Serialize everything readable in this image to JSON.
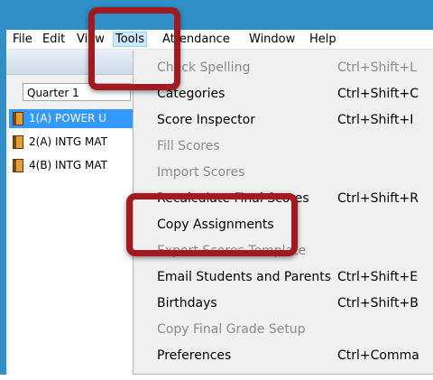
{
  "menubar": {
    "items": [
      {
        "label": "File"
      },
      {
        "label": "Edit"
      },
      {
        "label": "View"
      },
      {
        "label": "Tools"
      },
      {
        "label": "Attendance"
      },
      {
        "label": "Window"
      },
      {
        "label": "Help"
      }
    ]
  },
  "left_pane": {
    "term_select": "Quarter 1",
    "classes": [
      {
        "label": "1(A) POWER U",
        "selected": true
      },
      {
        "label": "2(A) INTG MAT",
        "selected": false
      },
      {
        "label": "4(B) INTG MAT",
        "selected": false
      }
    ]
  },
  "tools_menu": {
    "items": [
      {
        "label": "Check Spelling",
        "shortcut": "Ctrl+Shift+L",
        "enabled": false
      },
      {
        "label": "Categories",
        "shortcut": "Ctrl+Shift+C",
        "enabled": true
      },
      {
        "label": "Score Inspector",
        "shortcut": "Ctrl+Shift+I",
        "enabled": true
      },
      {
        "label": "Fill Scores",
        "shortcut": "",
        "enabled": false
      },
      {
        "label": "Import Scores",
        "shortcut": "",
        "enabled": false
      },
      {
        "label": "Recalculate Final Scores",
        "shortcut": "Ctrl+Shift+R",
        "enabled": true
      },
      {
        "label": "Copy Assignments",
        "shortcut": "",
        "enabled": true
      },
      {
        "label": "Export Scores Template",
        "shortcut": "",
        "enabled": false
      },
      {
        "label": "Email Students and Parents",
        "shortcut": "Ctrl+Shift+E",
        "enabled": true
      },
      {
        "label": "Birthdays",
        "shortcut": "Ctrl+Shift+B",
        "enabled": true
      },
      {
        "label": "Copy Final Grade Setup",
        "shortcut": "",
        "enabled": false
      },
      {
        "label": "Preferences",
        "shortcut": "Ctrl+Comma",
        "enabled": true
      }
    ]
  },
  "colors": {
    "highlight": "#a21a1f",
    "frame": "#2f8fc6",
    "selection": "#3399ff"
  }
}
